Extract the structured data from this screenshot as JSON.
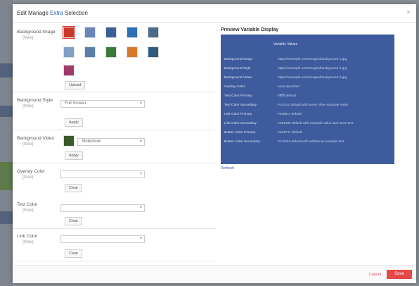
{
  "dialog": {
    "title_prefix": "Edit Manage",
    "title_accent": "Extra",
    "title_suffix": "Selection",
    "close_symbol": "×"
  },
  "settings": [
    {
      "label": "Background Image",
      "sub": "(free)",
      "button": "Upload"
    },
    {
      "label": "Background Style",
      "sub": "(free)",
      "select_value": "Full Screen",
      "button": "Apply"
    },
    {
      "label": "Background Video",
      "sub": "(free)",
      "select_value": "Slideshow",
      "button": "Apply"
    },
    {
      "label": "Overlay Color",
      "sub": "(free)",
      "select_value": "",
      "button": "Clear"
    },
    {
      "label": "Text Color",
      "sub": "(free)",
      "select_value": "",
      "button": "Clear"
    },
    {
      "label": "Link Color",
      "sub": "(free)",
      "select_value": "",
      "button": "Clear"
    }
  ],
  "thumbnails": [
    {
      "name": "red-flower",
      "color": "#c9392b"
    },
    {
      "name": "blue-sky",
      "color": "#6b86b8"
    },
    {
      "name": "city-night",
      "color": "#3c5f96"
    },
    {
      "name": "ocean",
      "color": "#2f6fb3"
    },
    {
      "name": "mountain",
      "color": "#4a6c8a"
    },
    {
      "name": "skyline",
      "color": "#7f9fc4"
    },
    {
      "name": "water",
      "color": "#5a7fa8"
    },
    {
      "name": "leaves",
      "color": "#3b7a3b"
    },
    {
      "name": "sunset",
      "color": "#d87a2a"
    },
    {
      "name": "forest",
      "color": "#2f5a7f"
    },
    {
      "name": "dusk",
      "color": "#a03a6a"
    }
  ],
  "preview": {
    "title": "Preview Variable Display",
    "header": "Variable Values",
    "rows": [
      {
        "k": "Background Image",
        "v": "https://example.com/images/background-1.jpg"
      },
      {
        "k": "Background Style",
        "v": "https://example.com/images/background-2.jpg"
      },
      {
        "k": "Background Video",
        "v": "https://example.com/images/background-3.jpg"
      },
      {
        "k": "Overlay Color",
        "v": "none specified"
      },
      {
        "k": "Text Color Primary",
        "v": "#ffffff default"
      },
      {
        "k": "Text Color Secondary",
        "v": "#cccccc default with some other example value"
      },
      {
        "k": "Link Color Primary",
        "v": "#3366cc default"
      },
      {
        "k": "Link Color Secondary",
        "v": "#224488 default with example value and more text"
      },
      {
        "k": "Button Color Primary",
        "v": "#e64747 default"
      },
      {
        "k": "Button Color Secondary",
        "v": "#cc3333 default with additional example text"
      }
    ],
    "refresh_label": "Refresh"
  },
  "footer": {
    "cancel_label": "Cancel",
    "primary_label": "Save"
  }
}
